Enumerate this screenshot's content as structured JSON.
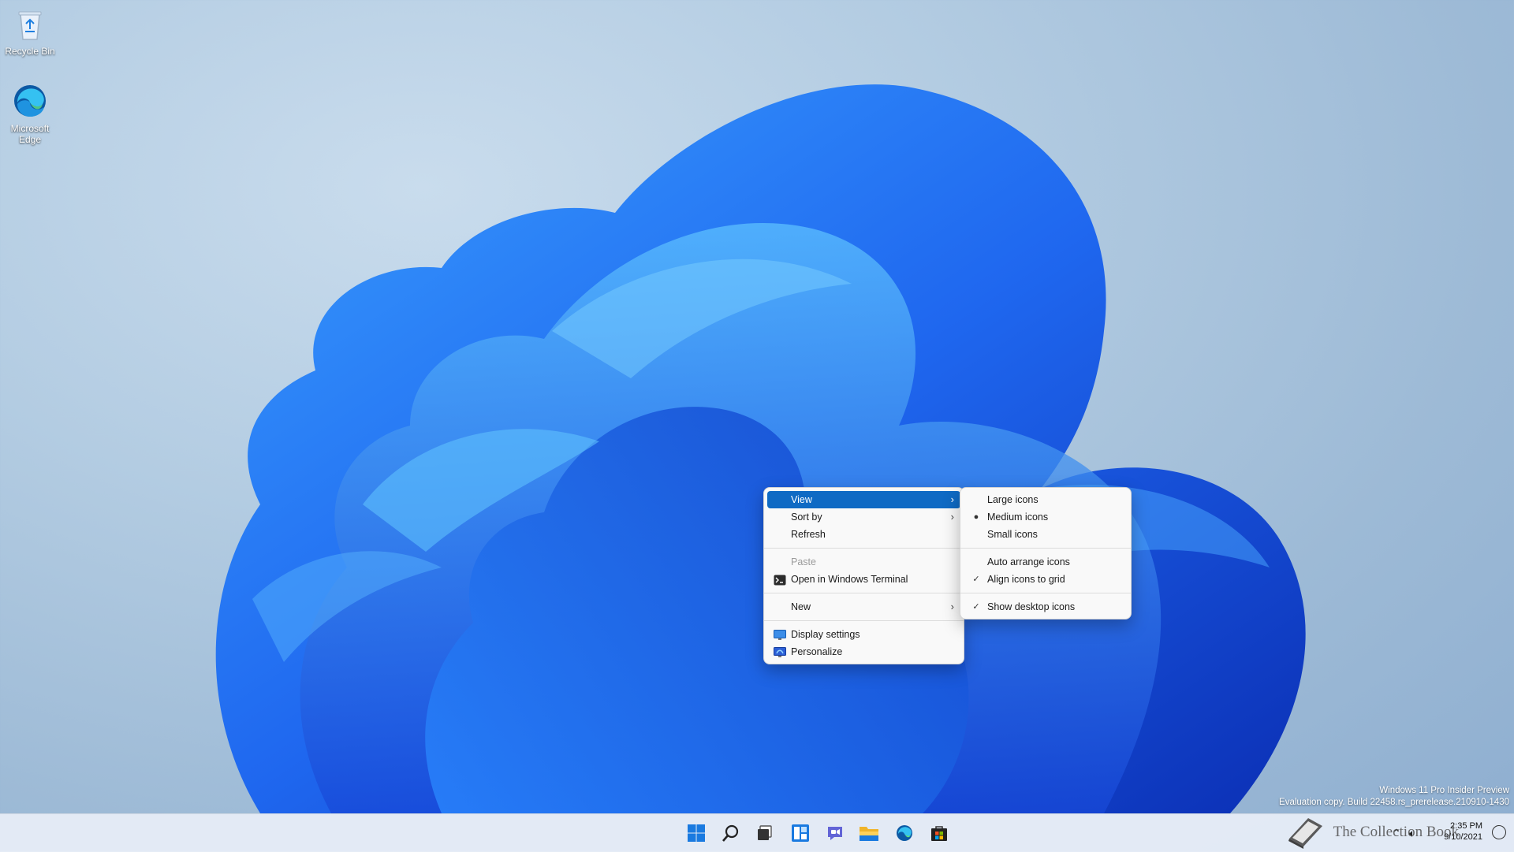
{
  "desktop": {
    "icons": [
      {
        "label": "Recycle Bin"
      },
      {
        "label": "Microsoft Edge"
      }
    ]
  },
  "context_menu": {
    "items": {
      "view": "View",
      "sort_by": "Sort by",
      "refresh": "Refresh",
      "paste": "Paste",
      "open_terminal": "Open in Windows Terminal",
      "new": "New",
      "display_settings": "Display settings",
      "personalize": "Personalize"
    },
    "highlight_color": "#0f6ac4"
  },
  "view_submenu": {
    "items": {
      "large_icons": "Large icons",
      "medium_icons": "Medium icons",
      "small_icons": "Small icons",
      "auto_arrange": "Auto arrange icons",
      "align_grid": "Align icons to grid",
      "show_desktop_icons": "Show desktop icons"
    },
    "selected": "Medium icons",
    "checked": [
      "Align icons to grid",
      "Show desktop icons"
    ]
  },
  "watermark": {
    "line1": "Windows 11 Pro Insider Preview",
    "line2": "Evaluation copy. Build 22458.rs_prerelease.210910-1430"
  },
  "taskbar": {
    "apps": [
      "start-icon",
      "search-icon",
      "task-view-icon",
      "widgets-icon",
      "chat-icon",
      "file-explorer-icon",
      "edge-icon",
      "store-icon"
    ],
    "clock": {
      "time": "2:35 PM",
      "date": "9/10/2021"
    }
  },
  "overlay": {
    "brand": "The Collection Book"
  },
  "colors": {
    "accent": "#0f6ac4",
    "bloom": "#1a5fe8"
  }
}
